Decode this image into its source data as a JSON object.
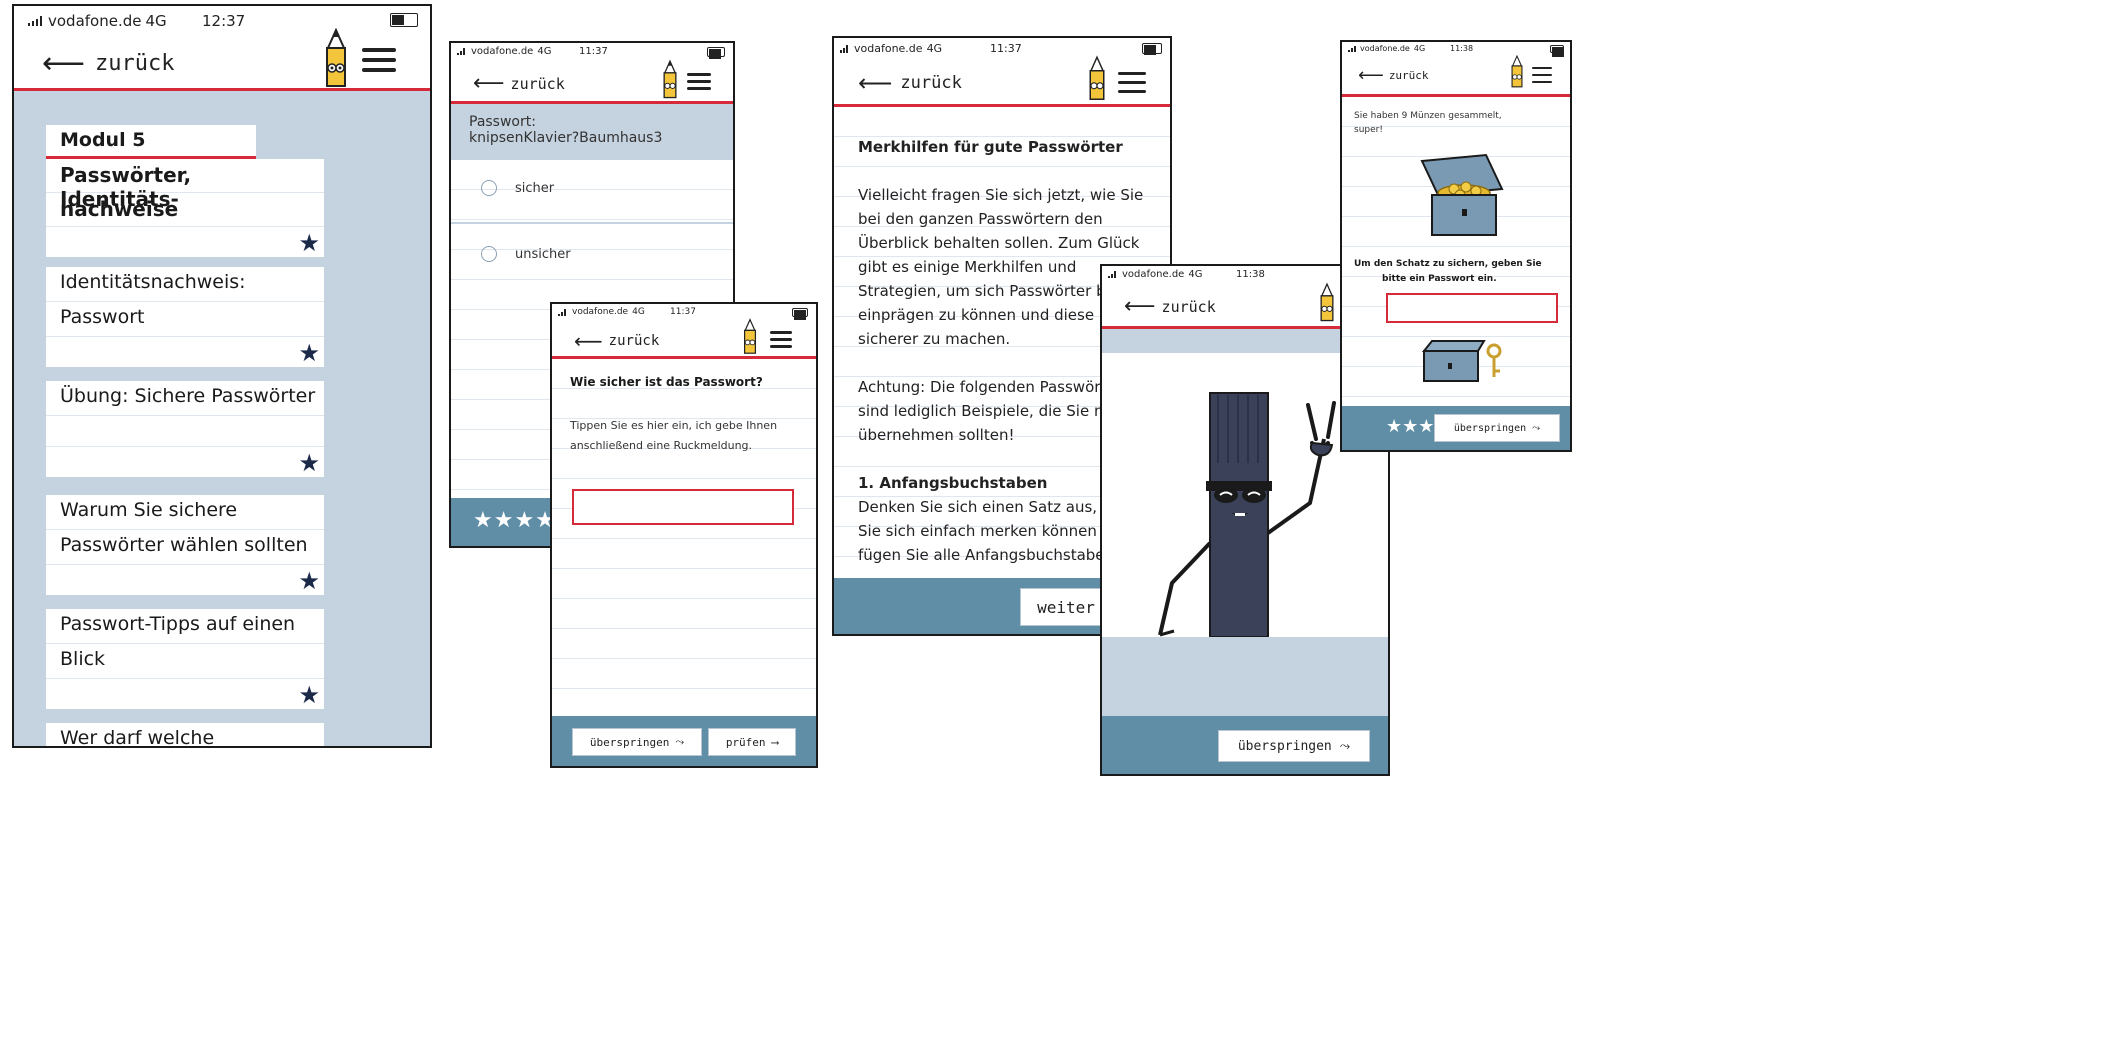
{
  "screens": {
    "modules": {
      "carrier": "vodafone.de",
      "network": "4G",
      "time": "12:37",
      "back_label": "zurück",
      "card1": {
        "line1": "Modul 5",
        "line2": "Passwörter, Identitäts-",
        "line3": "nachweise"
      },
      "card2": {
        "line1": "Identitätsnachweis:",
        "line2": "Passwort"
      },
      "card3": {
        "line1": "Übung: Sichere Passwörter"
      },
      "card4": {
        "line1": "Warum Sie sichere",
        "line2": "Passwörter wählen sollten"
      },
      "card5": {
        "line1": "Passwort-Tipps auf einen",
        "line2": "Blick"
      },
      "card6": {
        "line1": "Wer darf welche"
      },
      "star": "★"
    },
    "quiz": {
      "carrier": "vodafone.de",
      "network": "4G",
      "time": "11:37",
      "back_label": "zurück",
      "password_label": "Passwort:",
      "password_value": "knipsenKlavier?Baumhaus3",
      "option1": "sicher",
      "option2": "unsicher",
      "stars": "★★★★"
    },
    "enter": {
      "carrier": "vodafone.de",
      "network": "4G",
      "time": "11:37",
      "back_label": "zurück",
      "title": "Wie sicher ist das Passwort?",
      "text1": "Tippen Sie es hier ein, ich gebe Ihnen",
      "text2": "anschließend eine Ruckmeldung.",
      "input_value": "",
      "skip_label": "überspringen",
      "check_label": "prüfen"
    },
    "tips": {
      "carrier": "vodafone.de",
      "network": "4G",
      "time": "11:37",
      "back_label": "zurück",
      "heading": "Merkhilfen für gute Passwörter",
      "p1": [
        "Vielleicht fragen Sie sich jetzt, wie Sie",
        "bei den ganzen Passwörtern den",
        "Überblick behalten sollen. Zum Glück",
        "gibt es einige Merkhilfen und",
        "Strategien, um sich Passwörter b",
        "einprägen zu können und diese",
        "sicherer zu machen."
      ],
      "p2": [
        "Achtung: Die folgenden Passwört",
        "sind lediglich Beispiele, die Sie n",
        "übernehmen sollten!"
      ],
      "sub_heading": "1. Anfangsbuchstaben",
      "p3": [
        "Denken Sie sich einen Satz aus, d",
        "Sie sich einfach merken können u",
        "fügen Sie alle Anfangsbuchstabe"
      ],
      "next_label": "weiter"
    },
    "mascot": {
      "carrier": "vodafone.de",
      "network": "4G",
      "time": "11:38",
      "back_label": "zurück",
      "skip_label": "überspringen"
    },
    "treasure": {
      "carrier": "vodafone.de",
      "network": "4G",
      "time": "11:38",
      "back_label": "zurück",
      "text1": "Sie haben 9 Münzen gesammelt,",
      "text2": "super!",
      "prompt1": "Um den Schatz zu sichern, geben Sie",
      "prompt2": "bitte ein Passwort ein.",
      "input_value": "",
      "stars": "★★★",
      "skip_label": "überspringen"
    }
  },
  "colors": {
    "accent_red": "#d62a3a",
    "panel_blue": "#c5d2df",
    "footer_teal": "#5f8ea6",
    "navy": "#1c2a4a"
  }
}
